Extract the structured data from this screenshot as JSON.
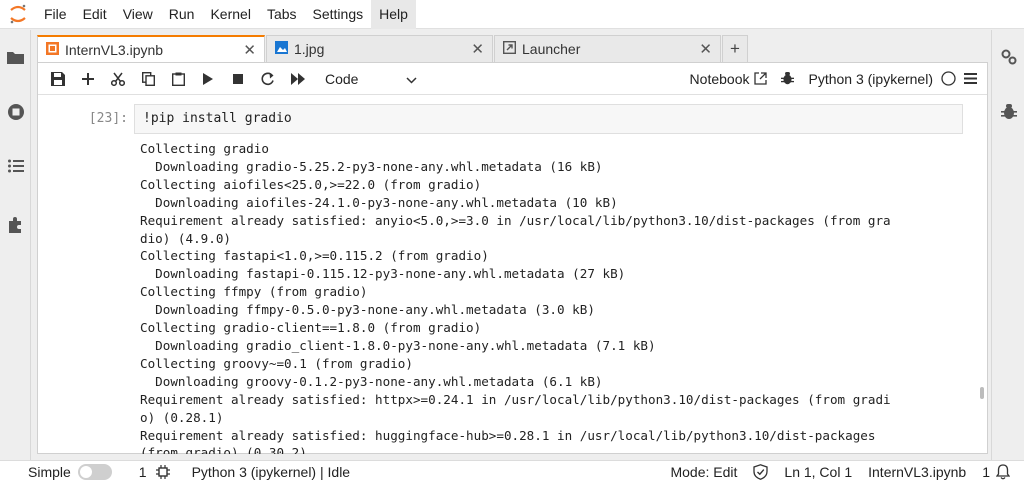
{
  "menubar": {
    "items": [
      "File",
      "Edit",
      "View",
      "Run",
      "Kernel",
      "Tabs",
      "Settings",
      "Help"
    ],
    "active": "Help"
  },
  "tabs": [
    {
      "label": "InternVL3.ipynb",
      "icon": "notebook-icon",
      "active": true
    },
    {
      "label": "1.jpg",
      "icon": "image-file-icon",
      "active": false
    },
    {
      "label": "Launcher",
      "icon": "launcher-icon",
      "active": false
    }
  ],
  "toolbar": {
    "cell_type": "Code",
    "notebook_label": "Notebook",
    "kernel_label": "Python 3 (ipykernel)"
  },
  "cell": {
    "prompt": "[23]:",
    "code": "!pip install gradio",
    "output_lines": [
      "Collecting gradio",
      "  Downloading gradio-5.25.2-py3-none-any.whl.metadata (16 kB)",
      "Collecting aiofiles<25.0,>=22.0 (from gradio)",
      "  Downloading aiofiles-24.1.0-py3-none-any.whl.metadata (10 kB)",
      "Requirement already satisfied: anyio<5.0,>=3.0 in /usr/local/lib/python3.10/dist-packages (from gra",
      "dio) (4.9.0)",
      "Collecting fastapi<1.0,>=0.115.2 (from gradio)",
      "  Downloading fastapi-0.115.12-py3-none-any.whl.metadata (27 kB)",
      "Collecting ffmpy (from gradio)",
      "  Downloading ffmpy-0.5.0-py3-none-any.whl.metadata (3.0 kB)",
      "Collecting gradio-client==1.8.0 (from gradio)",
      "  Downloading gradio_client-1.8.0-py3-none-any.whl.metadata (7.1 kB)",
      "Collecting groovy~=0.1 (from gradio)",
      "  Downloading groovy-0.1.2-py3-none-any.whl.metadata (6.1 kB)",
      "Requirement already satisfied: httpx>=0.24.1 in /usr/local/lib/python3.10/dist-packages (from gradi",
      "o) (0.28.1)",
      "Requirement already satisfied: huggingface-hub>=0.28.1 in /usr/local/lib/python3.10/dist-packages",
      "(from gradio) (0.30.2)"
    ]
  },
  "statusbar": {
    "mode_label": "Simple",
    "terminals": "1",
    "kernel_status": "Python 3 (ipykernel) | Idle",
    "mode": "Mode: Edit",
    "cursor": "Ln 1, Col 1",
    "filename": "InternVL3.ipynb",
    "notifications": "1"
  },
  "colors": {
    "accent": "#f57c00",
    "background": "#eeeeee"
  }
}
